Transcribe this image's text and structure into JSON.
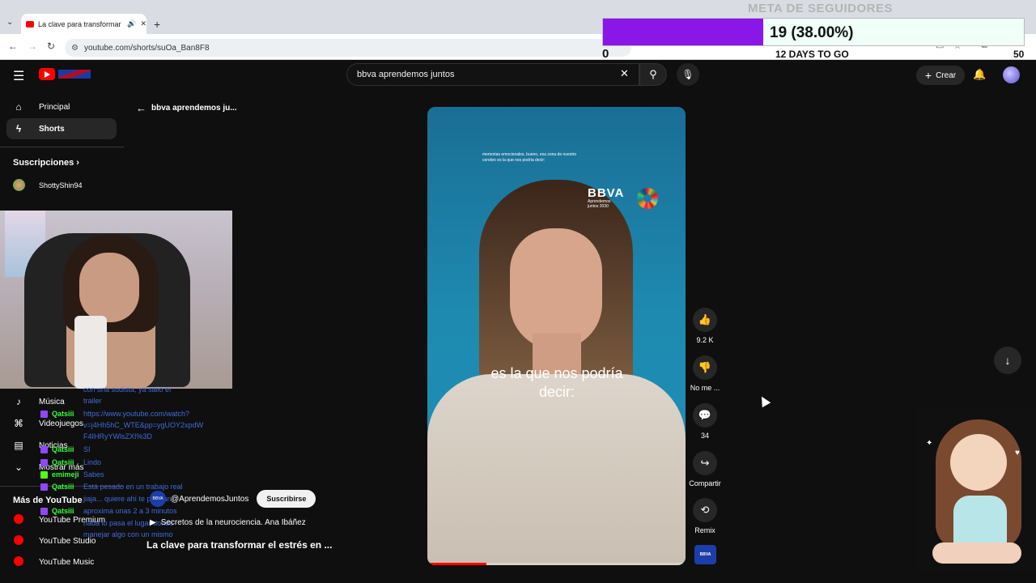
{
  "browser": {
    "tab_title": "La clave para transformar el",
    "url": "youtube.com/shorts/suOa_Ban8F8",
    "sound_icon": "speaker-icon",
    "close_icon": "close-icon",
    "new_tab": "+"
  },
  "follower_goal": {
    "title": "META DE SEGUIDORES",
    "value_text": "19 (38.00%)",
    "progress_fraction": 0.38,
    "min": "0",
    "max": "50",
    "remaining": "12 DAYS TO GO"
  },
  "header": {
    "search_value": "bbva aprendemos juntos",
    "create_label": "Crear"
  },
  "sidebar": {
    "items": [
      {
        "label": "Principal",
        "icon": "home-icon"
      },
      {
        "label": "Shorts",
        "icon": "shorts-icon"
      }
    ],
    "subscriptions_label": "Suscripciones",
    "channels": [
      {
        "label": "ShottyShin94"
      }
    ],
    "explore": [
      {
        "label": "Música",
        "icon": "music-icon"
      },
      {
        "label": "Videojuegos",
        "icon": "gaming-icon"
      },
      {
        "label": "Noticias",
        "icon": "news-icon"
      },
      {
        "label": "Mostrar más",
        "icon": "chevron-down-icon"
      }
    ],
    "more_label": "Más de YouTube",
    "more_items": [
      {
        "label": "YouTube Premium"
      },
      {
        "label": "YouTube Studio"
      },
      {
        "label": "YouTube Music"
      }
    ]
  },
  "back": {
    "label": "bbva aprendemos ju..."
  },
  "chat": {
    "users": [
      {
        "name": "Qatsiii"
      },
      {
        "name": "Qatsiii"
      },
      {
        "name": "Qatsiii"
      },
      {
        "name": "emimeji"
      },
      {
        "name": "Qatsiii"
      },
      {
        "name": "Qatsiii"
      }
    ],
    "messages": [
      "con una sudista, ya salió el",
      "trailer",
      "https://www.youtube.com/watch?",
      "v=j4Hh5hC_WTE&pp=ygUOY2xpdW",
      "F4IHRyYWlsZXI%3D",
      "SI",
      "Lindo",
      "Sabes",
      "Está pesado en un trabajo real",
      "jiaja... quiere ahí te prestan",
      "aproxima unas 2 a 3 minutos",
      "nada lo pasa el lugar donde",
      "manejar algo con un mismo"
    ]
  },
  "short": {
    "top_caption": "memorias emocionales, bueno, esa zona de nuestro cerebro es la que nos podría decir:",
    "brand": "BBVA",
    "brand_sub": "Aprendemos juntos 2030",
    "subtitle": "es la que nos podría decir:",
    "progress_fraction": 0.23,
    "channel_handle": "@AprendemosJuntos",
    "channel_badge": "BBVA",
    "subscribe_label": "Suscribirse",
    "playlist": "Secretos de la neurociencia. Ana Ibáñez",
    "title": "La clave para transformar el estrés en ..."
  },
  "actions": [
    {
      "label": "9.2 K",
      "icon": "like-icon"
    },
    {
      "label": "No me ...",
      "icon": "dislike-icon"
    },
    {
      "label": "34",
      "icon": "comment-icon"
    },
    {
      "label": "Compartir",
      "icon": "share-icon"
    },
    {
      "label": "Remix",
      "icon": "remix-icon"
    }
  ]
}
